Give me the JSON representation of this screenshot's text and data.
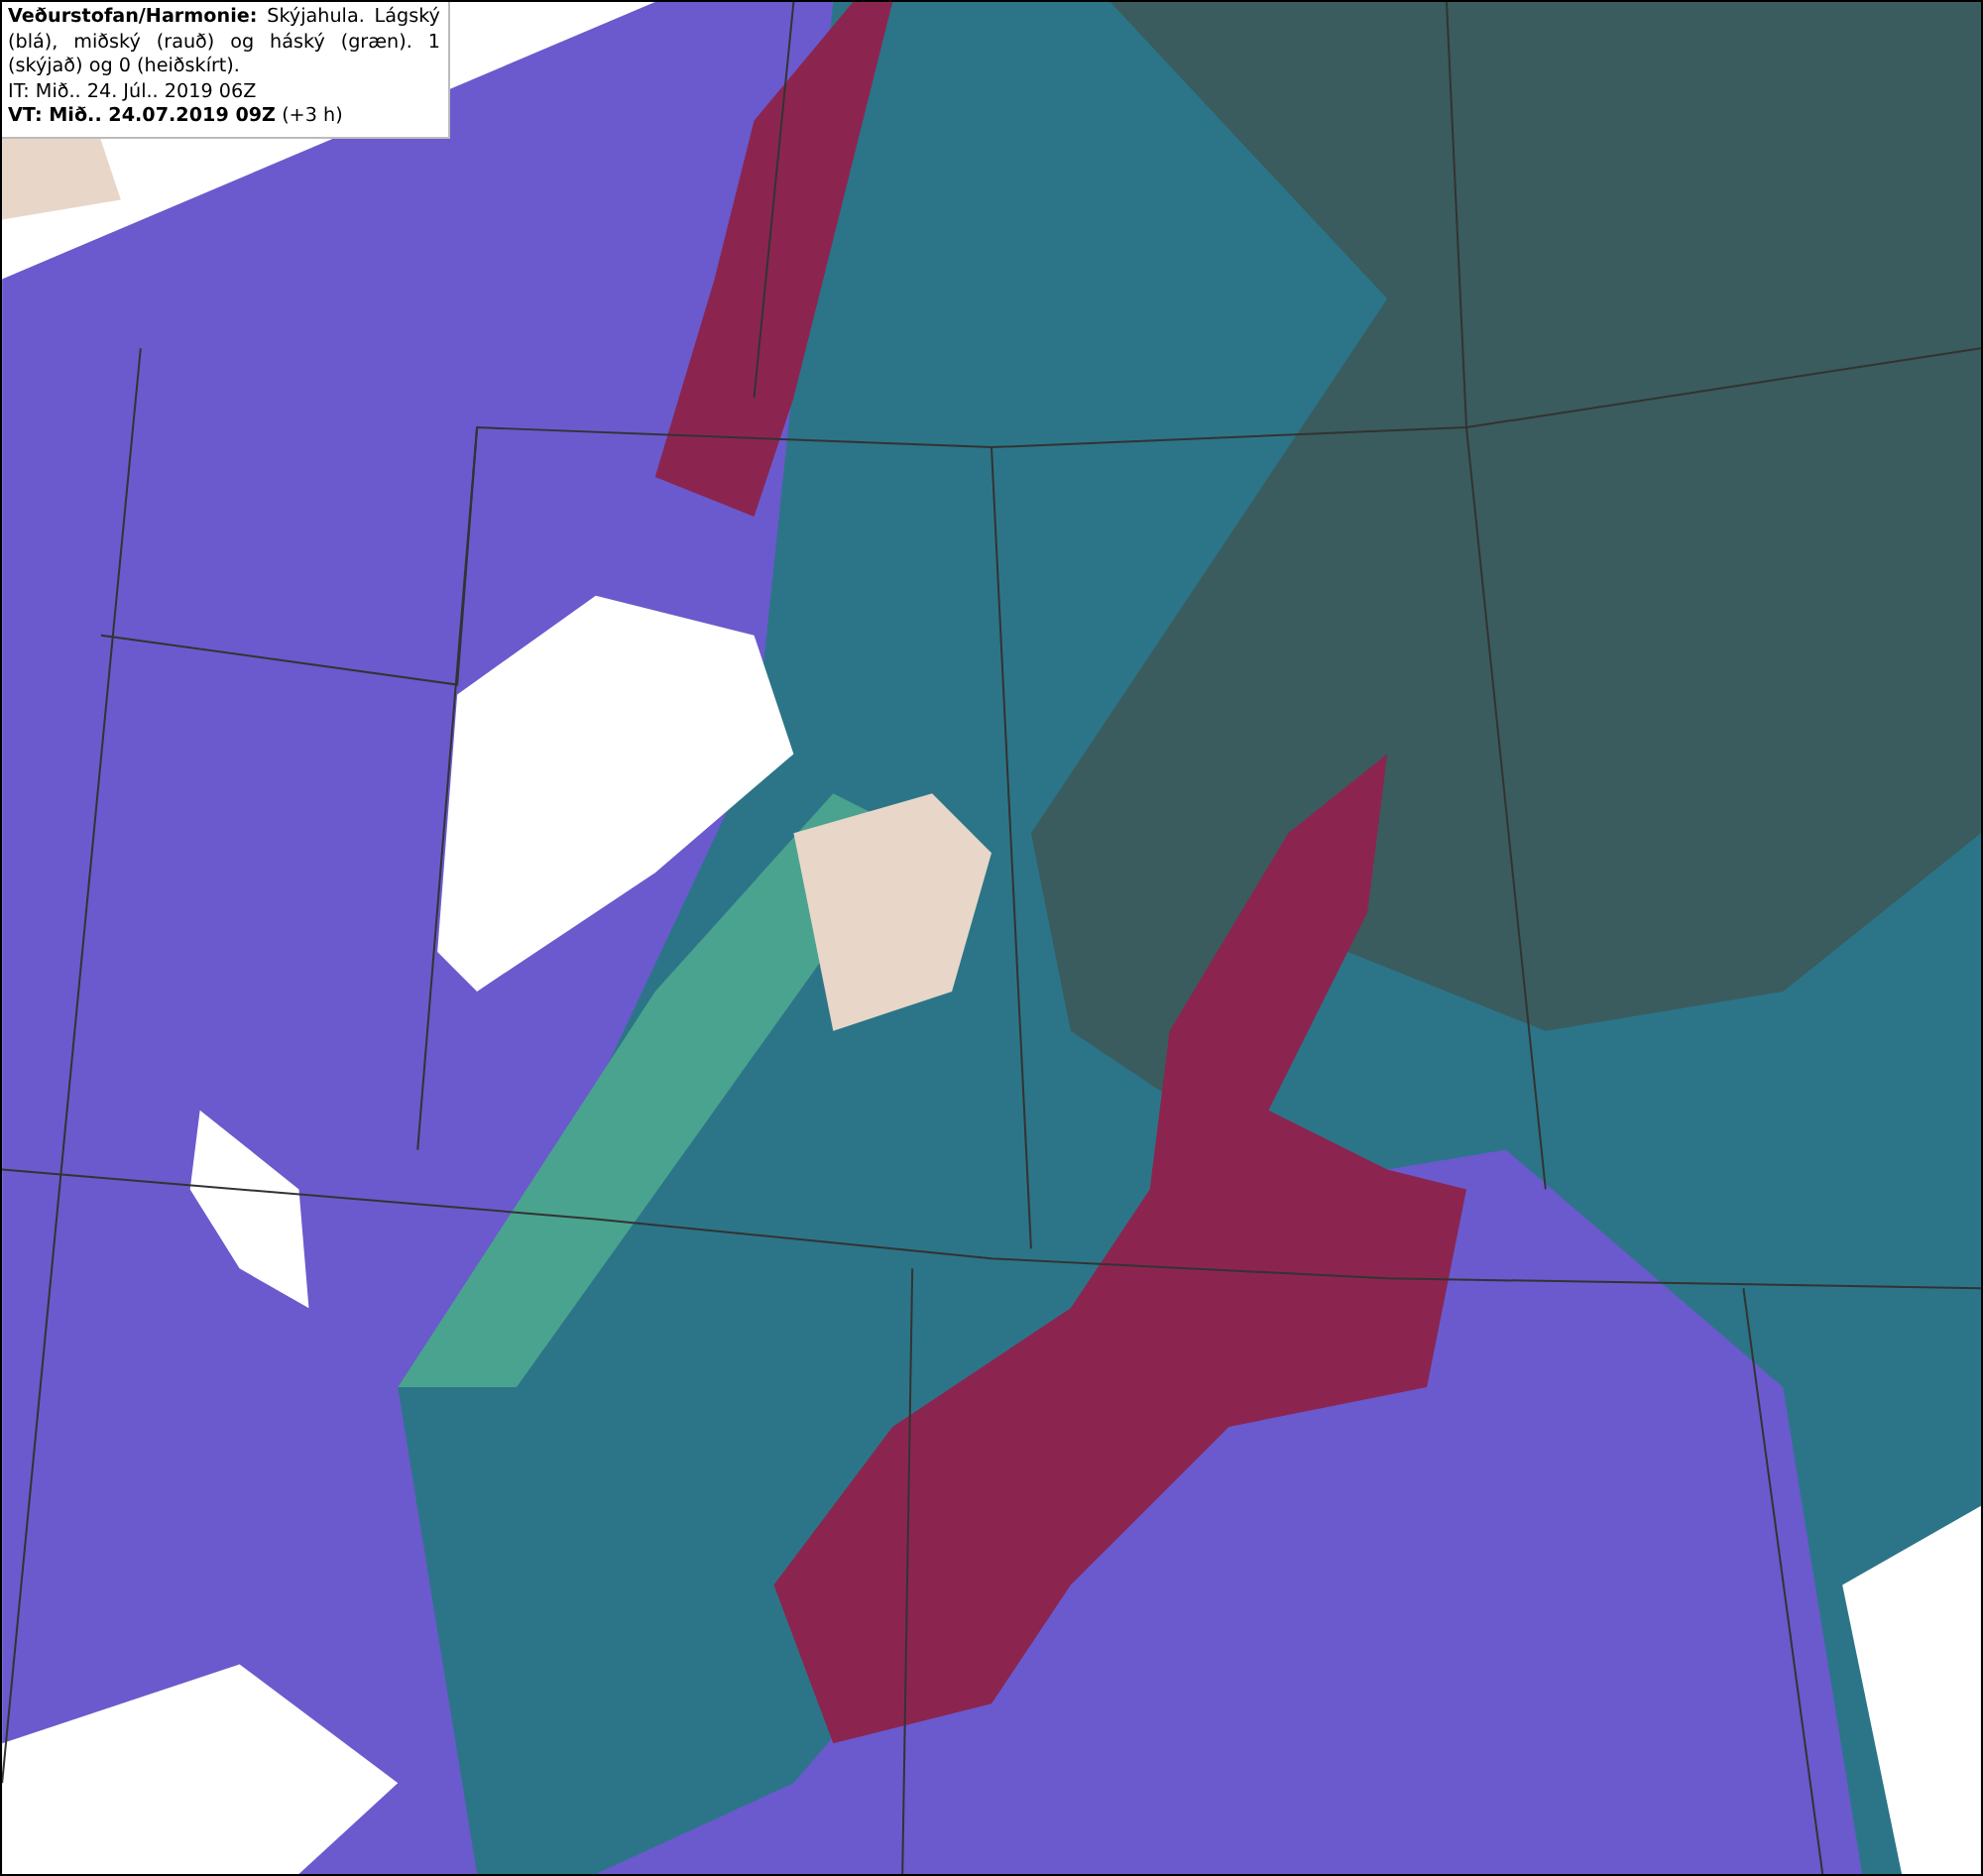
{
  "legend": {
    "description": "**Veðurstofan/Harmonie:** Skýjahula. Lágský (blá), miðský (rauð) og háský (græn). 1 (skýjað) og 0 (heiðskírt).",
    "issue_time": "IT: Mið.. 24. Júl.. 2019 06Z",
    "valid_time": "**VT: Mið.. 24.07.2019 09Z** (+3 h)"
  }
}
